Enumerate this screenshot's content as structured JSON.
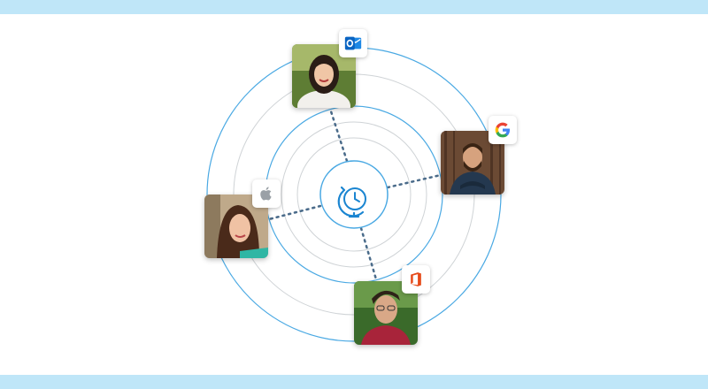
{
  "colors": {
    "band": "#bfe6f8",
    "ring_blue": "#4aa9e3",
    "ring_gray": "#cfd3d6",
    "connector": "#4a6b8a",
    "accent": "#1a85d1"
  },
  "center": {
    "icon": "globe-clock-icon"
  },
  "people": [
    {
      "name": "person-top",
      "badge_icon": "outlook-icon",
      "badge_color": "#0a64c2"
    },
    {
      "name": "person-right",
      "badge_icon": "google-icon",
      "badge_color": "#4285f4"
    },
    {
      "name": "person-left",
      "badge_icon": "apple-icon",
      "badge_color": "#9aa0a6"
    },
    {
      "name": "person-bottom",
      "badge_icon": "office-icon",
      "badge_color": "#e64a19"
    }
  ]
}
